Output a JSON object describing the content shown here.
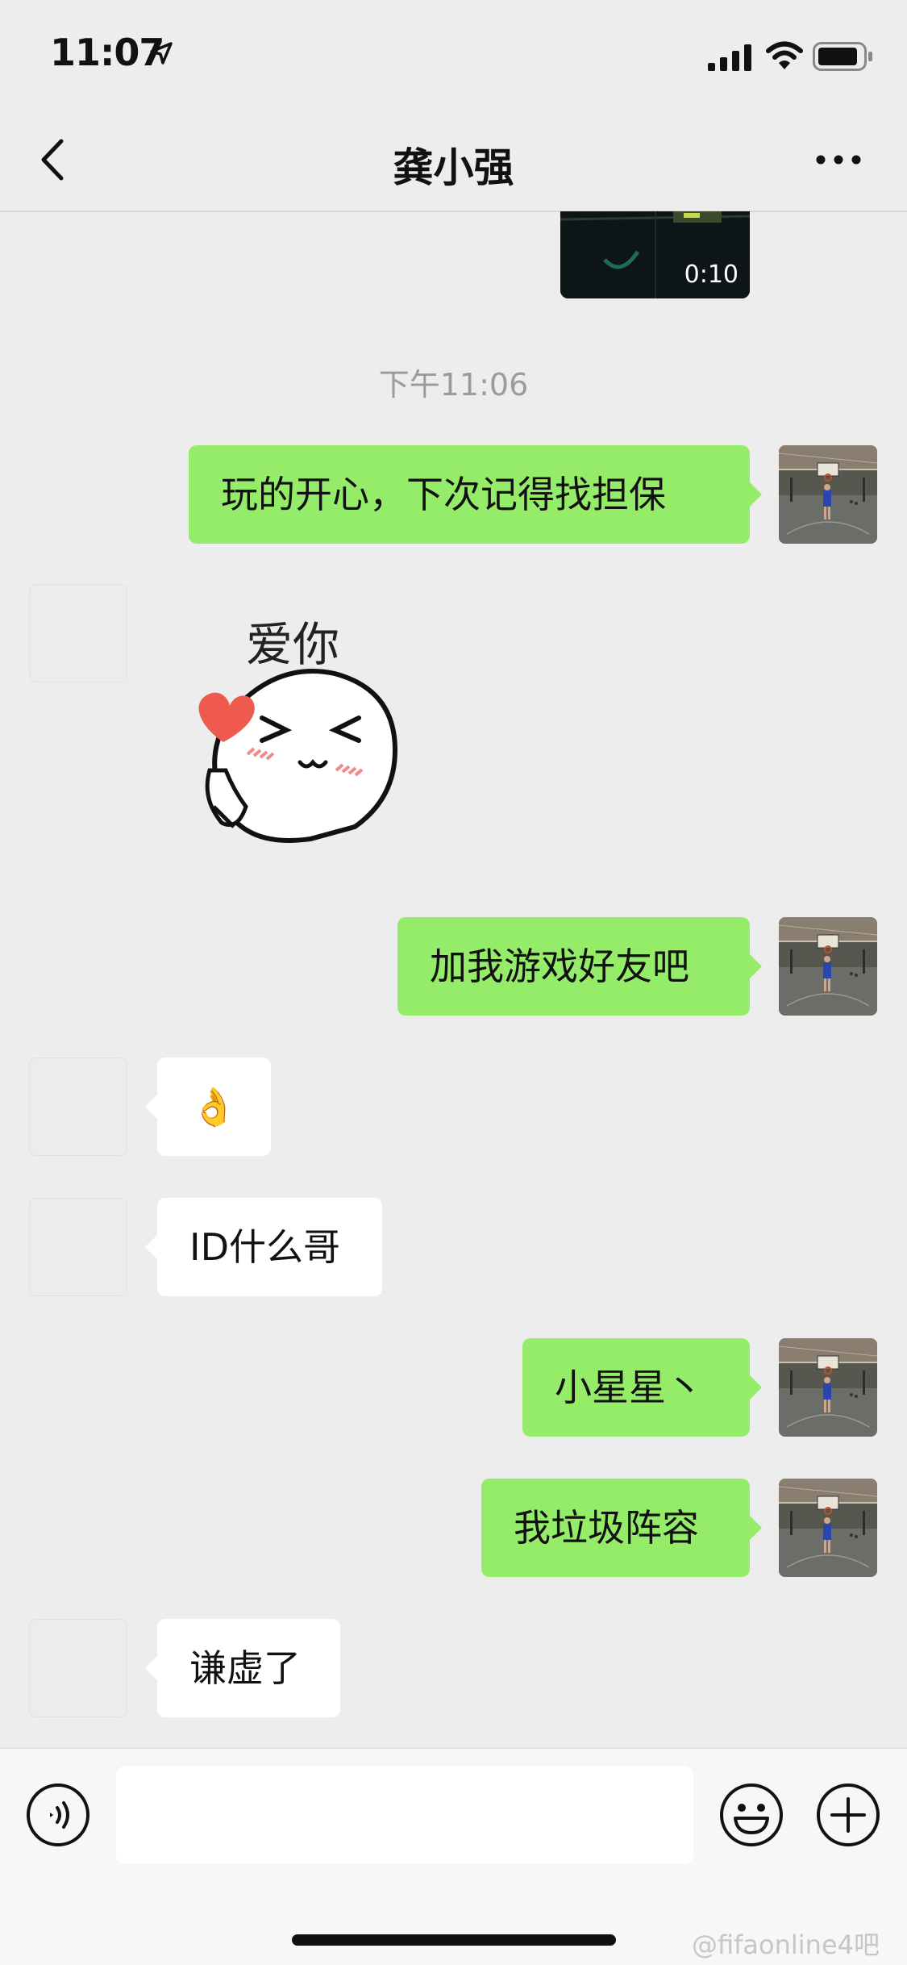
{
  "status_bar": {
    "time": "11:07"
  },
  "nav": {
    "title": "龚小强"
  },
  "video": {
    "duration": "0:10"
  },
  "timestamp": "下午11:06",
  "sticker": {
    "caption": "爱你"
  },
  "messages": [
    {
      "side": "out",
      "text": "玩的开心，下次记得找担保"
    },
    {
      "side": "out",
      "text": "加我游戏好友吧"
    },
    {
      "side": "in",
      "text": "👌"
    },
    {
      "side": "in",
      "text": "ID什么哥"
    },
    {
      "side": "out",
      "text": "小星星丶"
    },
    {
      "side": "out",
      "text": "我垃圾阵容"
    },
    {
      "side": "in",
      "text": "谦虚了"
    }
  ],
  "input": {
    "placeholder": ""
  },
  "watermark": "@fifaonline4吧",
  "colors": {
    "outgoing_bubble": "#95ec69",
    "incoming_bubble": "#ffffff",
    "background": "#ededed"
  },
  "icons": {
    "back": "chevron-left-icon",
    "more": "ellipsis-icon",
    "voice": "voice-icon",
    "emoji": "emoji-icon",
    "plus": "plus-icon"
  }
}
